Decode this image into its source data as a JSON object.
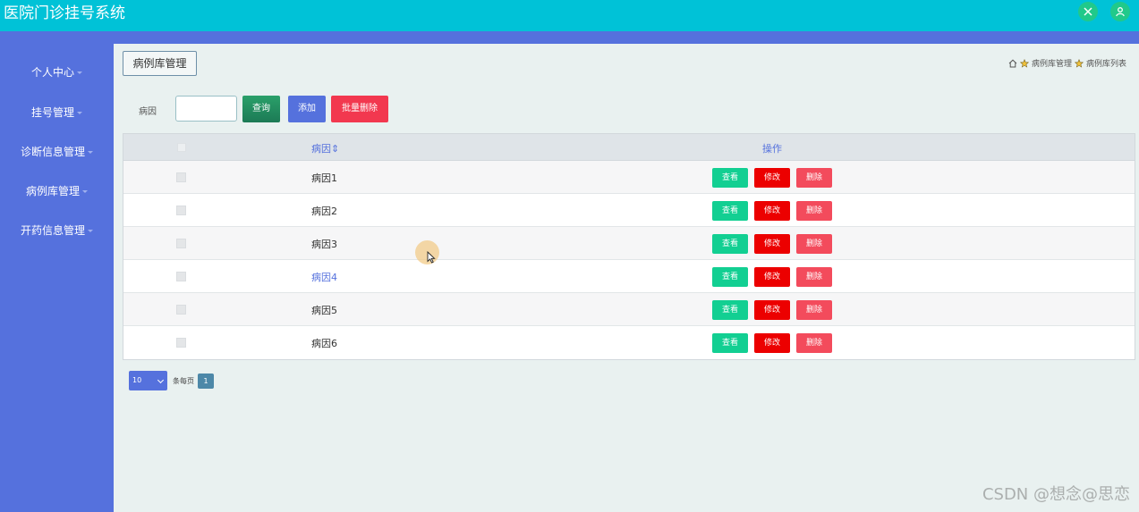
{
  "app": {
    "title": "医院门诊挂号系统"
  },
  "topbar": {
    "icons": [
      "expand-icon",
      "user-icon"
    ]
  },
  "sidebar": {
    "items": [
      {
        "label": "个人中心"
      },
      {
        "label": "挂号管理"
      },
      {
        "label": "诊断信息管理"
      },
      {
        "label": "病例库管理"
      },
      {
        "label": "开药信息管理"
      }
    ]
  },
  "page": {
    "title": "病例库管理",
    "breadcrumb": [
      "病例库管理",
      "病例库列表"
    ]
  },
  "search": {
    "label": "病因",
    "value": "",
    "query_label": "查询",
    "add_label": "添加",
    "batch_delete_label": "批量删除"
  },
  "table": {
    "headers": {
      "cause": "病因⇕",
      "ops": "操作"
    },
    "rows": [
      {
        "cause": "病因1"
      },
      {
        "cause": "病因2"
      },
      {
        "cause": "病因3"
      },
      {
        "cause": "病因4"
      },
      {
        "cause": "病因5"
      },
      {
        "cause": "病因6"
      }
    ],
    "actions": {
      "view": "查看",
      "edit": "修改",
      "delete": "删除"
    }
  },
  "pagination": {
    "page_size": "10",
    "per_page_label": "条每页",
    "current_page": "1"
  },
  "watermark": "CSDN @想念@思恋",
  "colors": {
    "topbar": "#00c2d7",
    "sidebar": "#5571dd",
    "view": "#12cf92",
    "edit": "#ec0000",
    "delete": "#f34b5c"
  }
}
